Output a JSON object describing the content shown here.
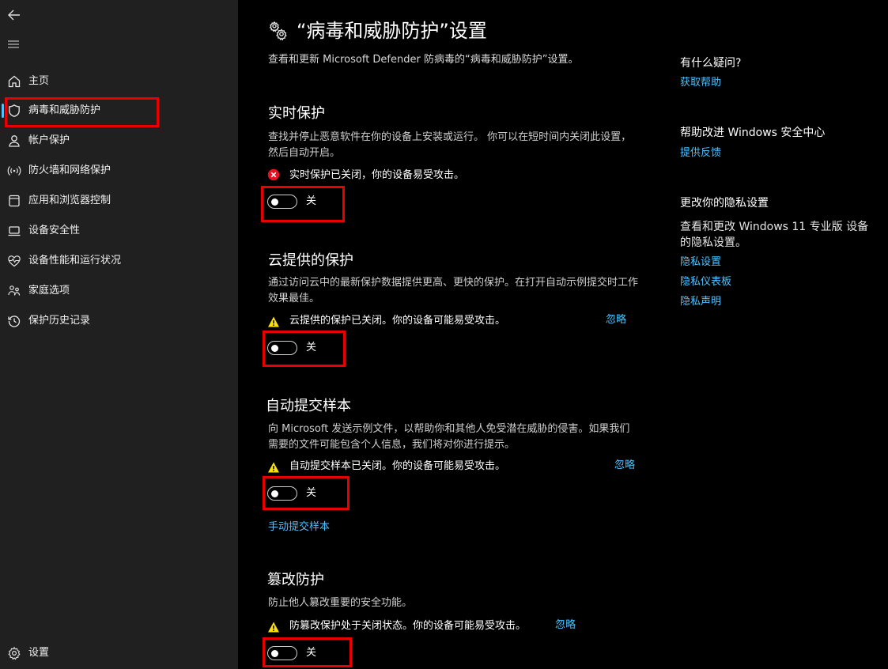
{
  "sidebar": {
    "items": [
      {
        "label": "主页",
        "icon": "home-icon"
      },
      {
        "label": "病毒和威胁防护",
        "icon": "shield-icon"
      },
      {
        "label": "帐户保护",
        "icon": "person-icon"
      },
      {
        "label": "防火墙和网络保护",
        "icon": "wifi-signal-icon"
      },
      {
        "label": "应用和浏览器控制",
        "icon": "app-window-icon"
      },
      {
        "label": "设备安全性",
        "icon": "laptop-icon"
      },
      {
        "label": "设备性能和运行状况",
        "icon": "heart-pulse-icon"
      },
      {
        "label": "家庭选项",
        "icon": "family-icon"
      },
      {
        "label": "保护历史记录",
        "icon": "history-icon"
      }
    ],
    "settings_label": "设置"
  },
  "header": {
    "title": "“病毒和威胁防护”设置",
    "subtitle": "查看和更新 Microsoft Defender 防病毒的“病毒和威胁防护”设置。"
  },
  "sections": {
    "realtime": {
      "title": "实时保护",
      "description": "查找并停止恶意软件在你的设备上安装或运行。 你可以在短时间内关闭此设置，然后自动开启。",
      "status": "实时保护已关闭，你的设备易受攻击。",
      "toggle_label": "关"
    },
    "cloud": {
      "title": "云提供的保护",
      "description": "通过访问云中的最新保护数据提供更高、更快的保护。在打开自动示例提交时工作效果最佳。",
      "status": "云提供的保护已关闭。你的设备可能易受攻击。",
      "dismiss": "忽略",
      "toggle_label": "关"
    },
    "sample": {
      "title": "自动提交样本",
      "description": "向 Microsoft 发送示例文件，以帮助你和其他人免受潜在威胁的侵害。如果我们需要的文件可能包含个人信息，我们将对你进行提示。",
      "status": "自动提交样本已关闭。你的设备可能易受攻击。",
      "dismiss": "忽略",
      "toggle_label": "关",
      "manual_link": "手动提交样本"
    },
    "tamper": {
      "title": "篡改防护",
      "description": "防止他人篡改重要的安全功能。",
      "status": "防篡改保护处于关闭状态。你的设备可能易受攻击。",
      "dismiss": "忽略",
      "toggle_label": "关"
    }
  },
  "right_panel": {
    "question_heading": "有什么疑问?",
    "get_help": "获取帮助",
    "improve_heading": "帮助改进 Windows 安全中心",
    "feedback": "提供反馈",
    "privacy_heading": "更改你的隐私设置",
    "privacy_text": "查看和更改 Windows 11 专业版 设备的隐私设置。",
    "privacy_links": [
      "隐私设置",
      "隐私仪表板",
      "隐私声明"
    ]
  },
  "colors": {
    "accent": "#4cc2ff",
    "highlight_box": "#e60000",
    "error": "#e81123",
    "warning": "#fce100",
    "sidebar_bg": "#202020",
    "main_bg": "#000000"
  }
}
